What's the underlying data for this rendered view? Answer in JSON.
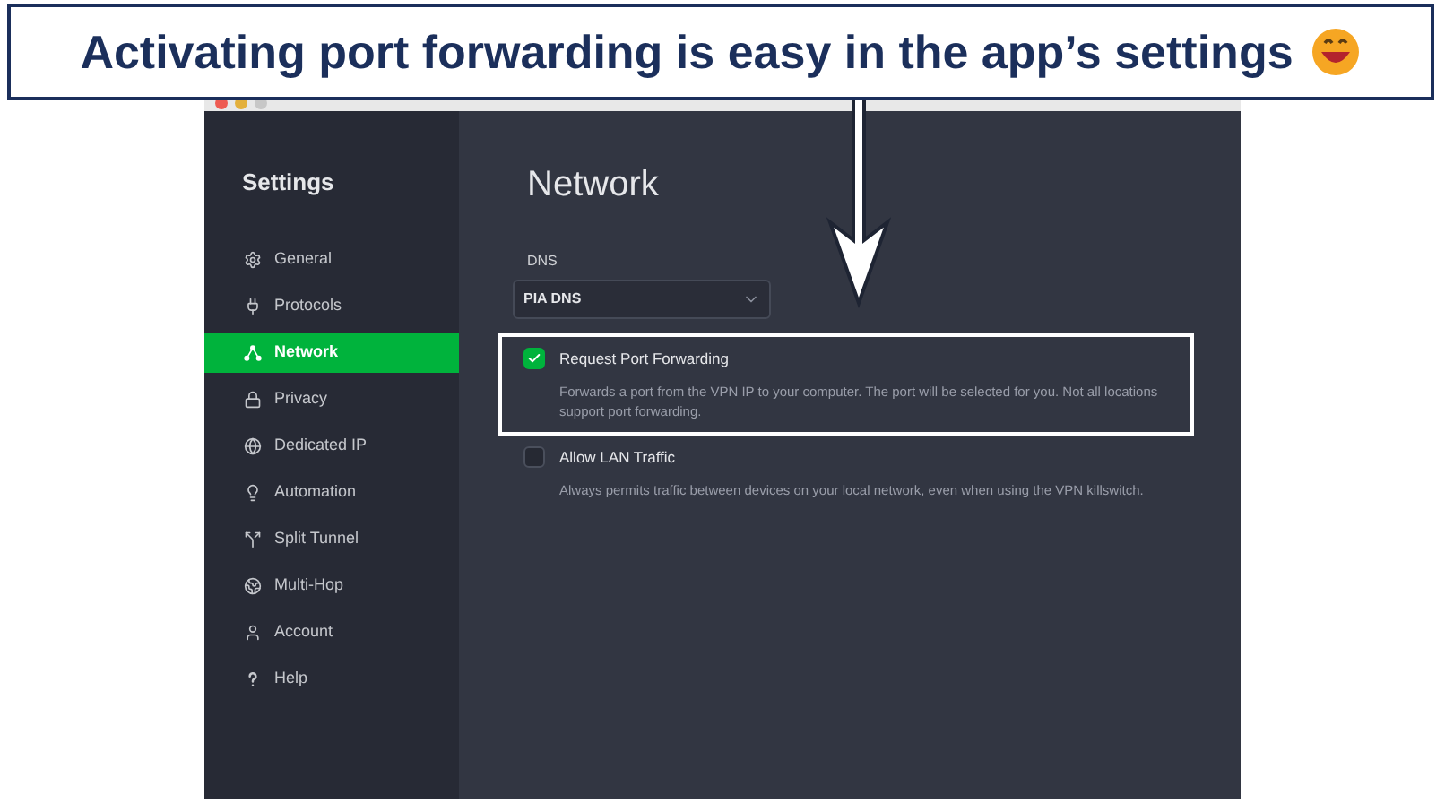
{
  "caption": "Activating port forwarding is easy in the app’s settings",
  "sidebar": {
    "title": "Settings",
    "items": [
      {
        "label": "General",
        "selected": false
      },
      {
        "label": "Protocols",
        "selected": false
      },
      {
        "label": "Network",
        "selected": true
      },
      {
        "label": "Privacy",
        "selected": false
      },
      {
        "label": "Dedicated IP",
        "selected": false
      },
      {
        "label": "Automation",
        "selected": false
      },
      {
        "label": "Split Tunnel",
        "selected": false
      },
      {
        "label": "Multi-Hop",
        "selected": false
      },
      {
        "label": "Account",
        "selected": false
      },
      {
        "label": "Help",
        "selected": false
      }
    ]
  },
  "page": {
    "title": "Network",
    "dns": {
      "label": "DNS",
      "value": "PIA DNS"
    },
    "options": [
      {
        "label": "Request Port Forwarding",
        "description": "Forwards a port from the VPN IP to your computer. The port will be selected for you. Not all locations support port forwarding.",
        "checked": true,
        "highlighted": true
      },
      {
        "label": "Allow LAN Traffic",
        "description": "Always permits traffic between devices on your local network, even when using the VPN killswitch.",
        "checked": false,
        "highlighted": false
      }
    ]
  }
}
